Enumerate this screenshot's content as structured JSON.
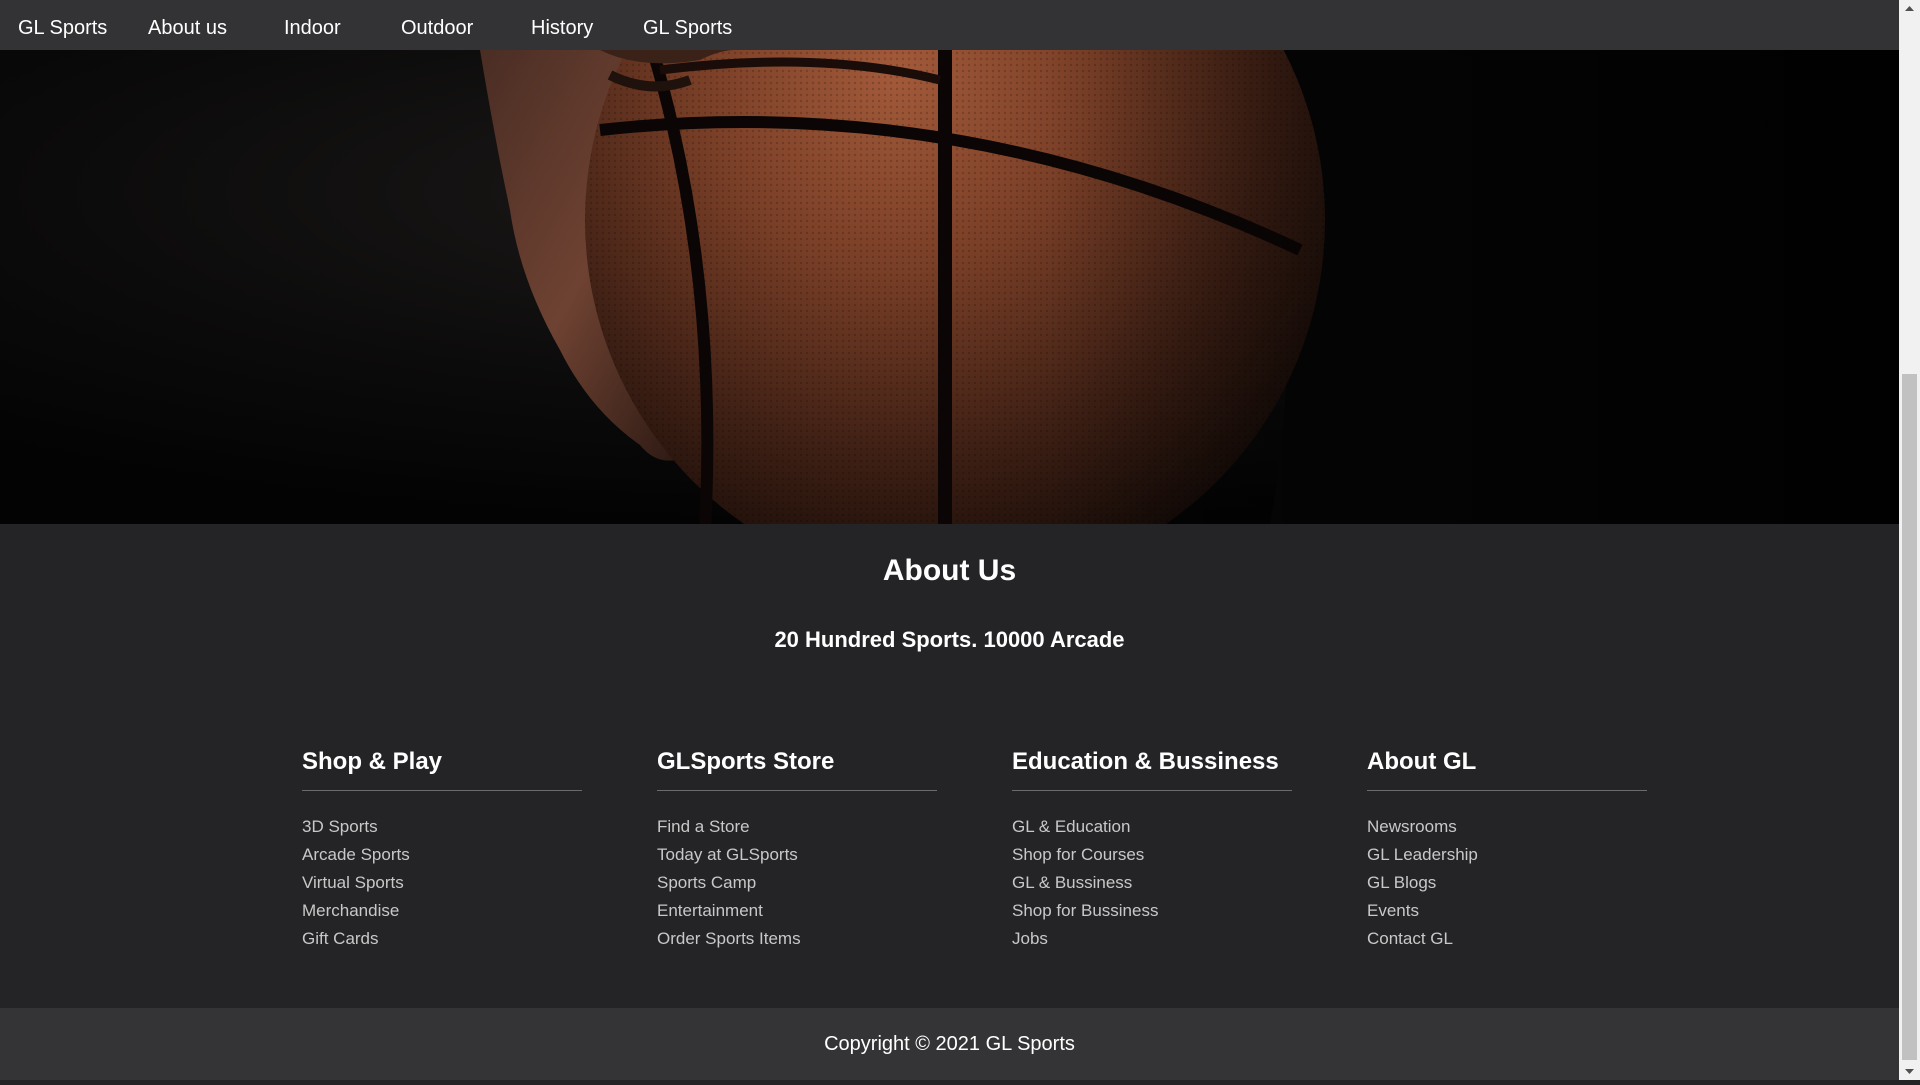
{
  "nav": {
    "items": [
      {
        "label": "GL Sports"
      },
      {
        "label": "About us"
      },
      {
        "label": "Indoor"
      },
      {
        "label": "Outdoor"
      },
      {
        "label": "History"
      },
      {
        "label": "GL Sports"
      }
    ]
  },
  "hero": {
    "image": "basketball-held-in-hand-dark-background"
  },
  "about": {
    "title": "About Us",
    "subtitle": "20 Hundred Sports. 10000 Arcade"
  },
  "columns": [
    {
      "title": "Shop & Play",
      "links": [
        "3D Sports",
        "Arcade Sports",
        "Virtual Sports",
        "Merchandise",
        "Gift Cards"
      ]
    },
    {
      "title": "GLSports Store",
      "links": [
        "Find a Store",
        "Today at GLSports",
        "Sports Camp",
        "Entertainment",
        "Order Sports Items"
      ]
    },
    {
      "title": "Education & Bussiness",
      "links": [
        "GL & Education",
        "Shop for Courses",
        "GL & Bussiness",
        "Shop for Bussiness",
        "Jobs"
      ]
    },
    {
      "title": "About GL",
      "links": [
        "Newsrooms",
        "GL Leadership",
        "GL Blogs",
        "Events",
        "Contact GL"
      ]
    }
  ],
  "footer": {
    "copyright": "Copyright © 2021 GL Sports"
  },
  "colors": {
    "nav_bg": "#333335",
    "section_bg": "#242427",
    "footer_bg": "#343436",
    "text": "#ffffff",
    "link": "#c8c8c8"
  }
}
